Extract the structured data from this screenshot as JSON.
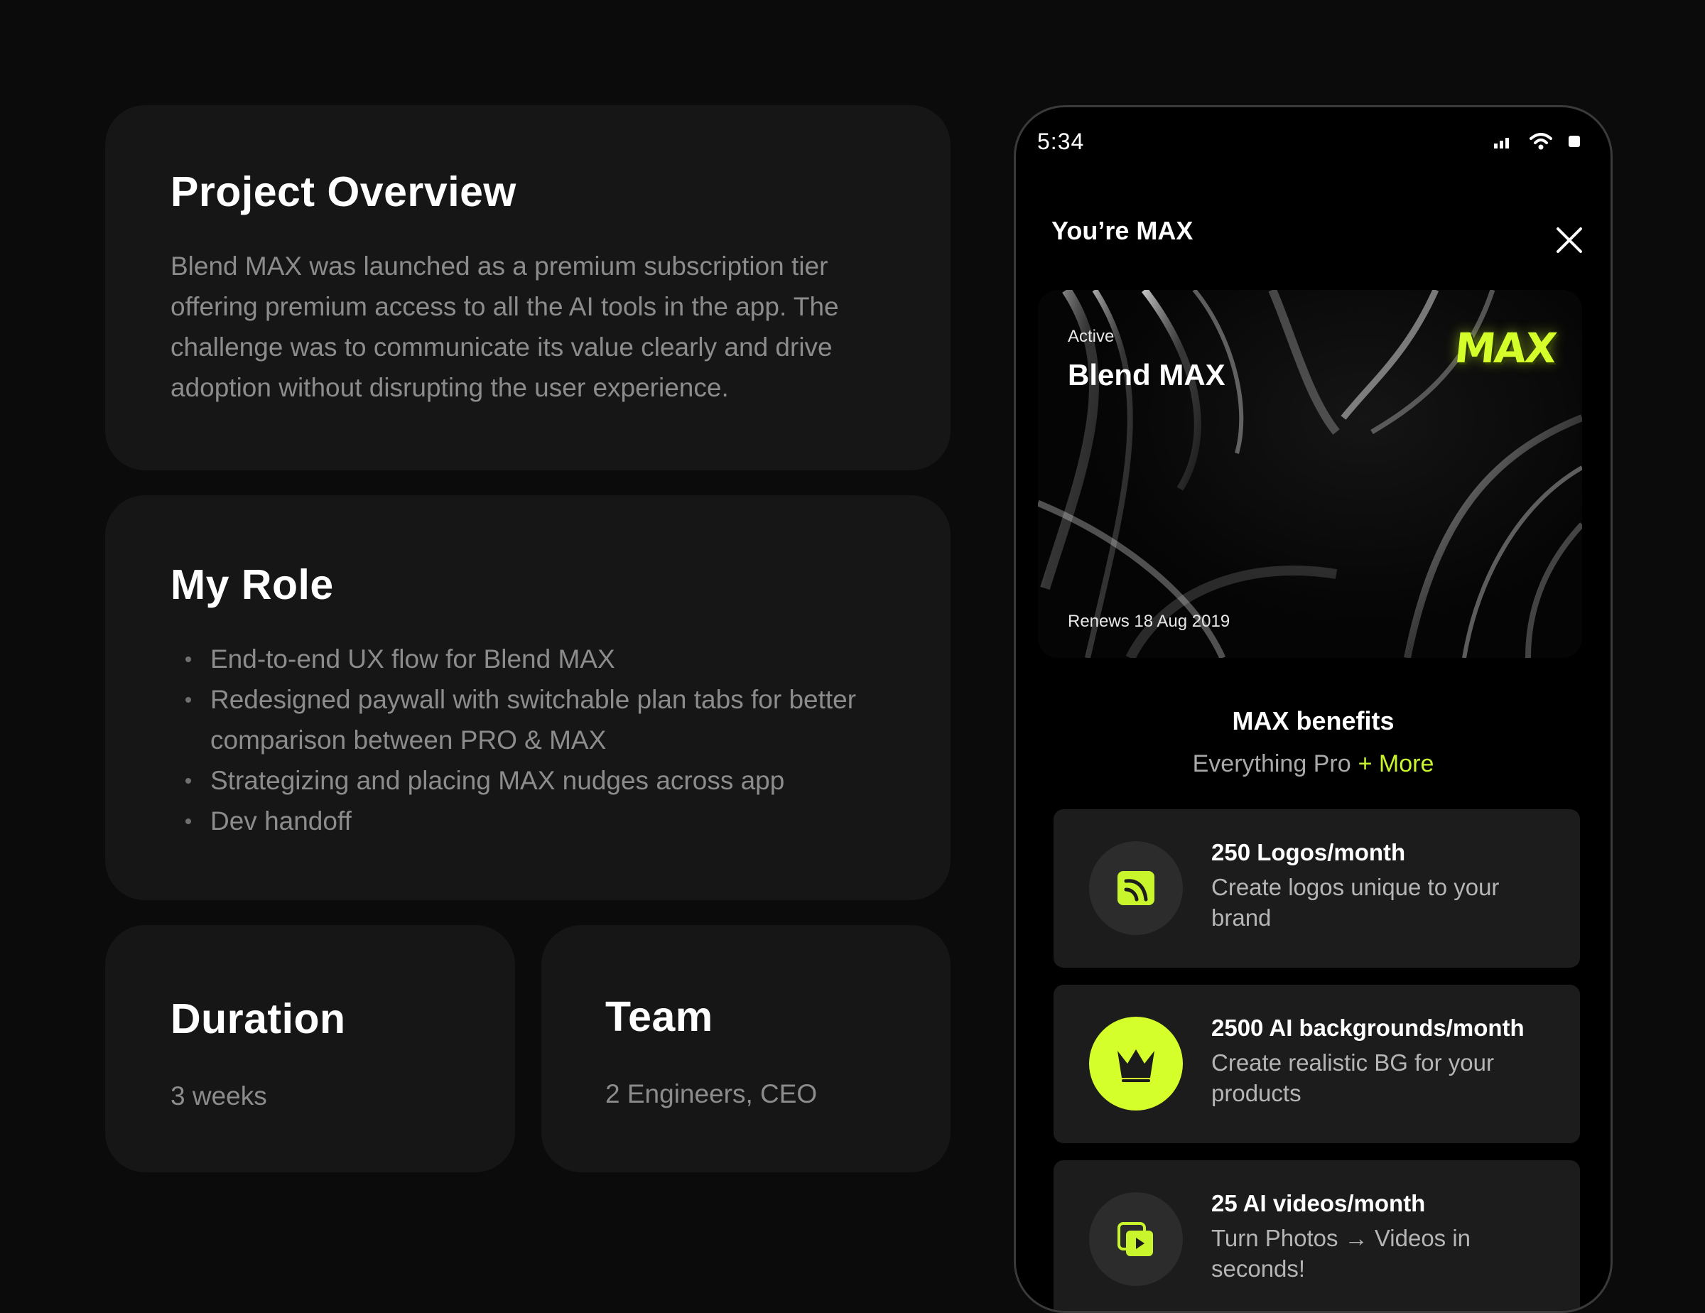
{
  "overview": {
    "title": "Project Overview",
    "body": "Blend MAX was launched as a premium subscription tier offering premium access to all the AI tools in the app. The challenge was to communicate its value clearly and drive adoption without disrupting the user experience."
  },
  "role": {
    "title": "My Role",
    "items": [
      "End-to-end UX flow for Blend MAX",
      "Redesigned paywall with switchable plan tabs for better comparison between PRO & MAX",
      "Strategizing and placing MAX nudges across app",
      "Dev handoff"
    ]
  },
  "duration": {
    "title": "Duration",
    "value": "3 weeks"
  },
  "team": {
    "title": "Team",
    "value": "2 Engineers, CEO"
  },
  "phone": {
    "status_time": "5:34",
    "status_icons": [
      "signal-icon",
      "wifi-icon",
      "battery-icon"
    ],
    "title": "You’re MAX",
    "close_icon": "close-icon",
    "banner": {
      "status": "Active",
      "title": "Blend MAX",
      "logo_text": "MAX",
      "renews": "Renews 18 Aug 2019"
    },
    "benefits_title": "MAX benefits",
    "benefits_sub": "Everything Pro",
    "benefits_more": "+ More",
    "benefits": [
      {
        "icon": "logo-mark-icon",
        "title": "250 Logos/month",
        "desc": "Create logos unique to your brand"
      },
      {
        "icon": "crown-background-icon",
        "title": "2500 AI backgrounds/month",
        "desc": "Create realistic BG for your products"
      },
      {
        "icon": "video-play-icon",
        "title": "25 AI videos/month",
        "desc": "Turn Photos → Videos in seconds!"
      }
    ]
  },
  "colors": {
    "accent": "#d4ff2a",
    "card": "#161616",
    "background": "#0b0b0b"
  }
}
